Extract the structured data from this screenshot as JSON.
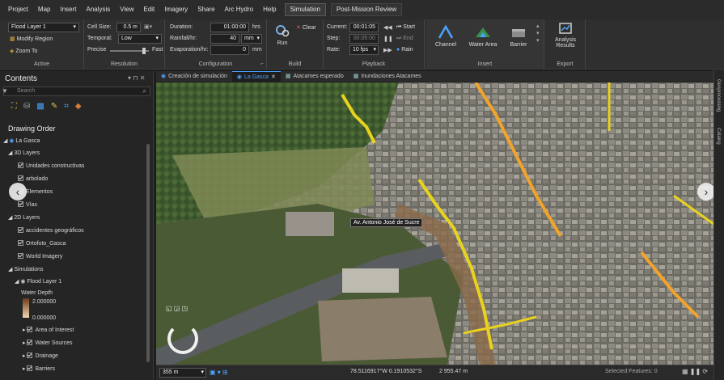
{
  "menu": {
    "items": [
      "Project",
      "Map",
      "Insert",
      "Analysis",
      "View",
      "Edit",
      "Imagery",
      "Share",
      "Arc Hydro",
      "Help"
    ],
    "active_tab": "Simulation",
    "second_tab": "Post-Mission Review"
  },
  "ribbon": {
    "active": {
      "layer_select": "Flood Layer 1",
      "modify_region": "Modify Region",
      "zoom_to": "Zoom To",
      "label": "Active"
    },
    "resolution": {
      "cell_size_label": "Cell Size:",
      "cell_size_value": "0.5 m",
      "temporal_label": "Temporal:",
      "temporal_value": "Low",
      "precise_label": "Precise",
      "fast_label": "Fast",
      "label": "Resolution"
    },
    "configuration": {
      "duration_label": "Duration:",
      "duration_value": "01:00:00",
      "duration_unit": "hrs",
      "rainfall_label": "Rainfall/hr:",
      "rainfall_value": "40",
      "rainfall_unit": "mm",
      "evap_label": "Evaporation/hr:",
      "evap_value": "0",
      "evap_unit": "mm",
      "label": "Configuration"
    },
    "build": {
      "run": "Run",
      "clear": "Clear",
      "label": "Build"
    },
    "playback": {
      "current_label": "Current:",
      "current_value": "00:01:05",
      "step_label": "Step:",
      "step_value": "00:05:00",
      "rate_label": "Rate:",
      "rate_value": "10 fps",
      "start": "Start",
      "end": "End",
      "rain": "Rain",
      "label": "Playback"
    },
    "insert": {
      "channel": "Channel",
      "water_area": "Water Area",
      "barrier": "Barrier",
      "label": "Insert"
    },
    "export": {
      "analysis_results_1": "Analysis",
      "analysis_results_2": "Results",
      "label": "Export"
    }
  },
  "contents": {
    "title": "Contents",
    "search_placeholder": "Search",
    "drawing_order": "Drawing Order",
    "map_name": "La Gasca",
    "groups": {
      "layers_3d": "3D Layers",
      "layers_2d": "2D Layers",
      "simulations": "Simulations"
    },
    "items_3d": [
      "Unidades constructivas",
      "arbolado",
      "Elementos",
      "Vías"
    ],
    "items_2d": [
      "accidentes geográficos",
      "Ortofoto_Gasca",
      "World Imagery"
    ],
    "flood_layer": "Flood Layer 1",
    "water_depth": "Water Depth",
    "depth_max": "2.000000",
    "depth_min": "0.000000",
    "sim_items": [
      "Area of Interest",
      "Water Sources",
      "Drainage",
      "Barriers"
    ]
  },
  "map_tabs": [
    "Creación de simulación",
    "La Gasca",
    "Atacames esperado",
    "Inundaciones Atacames"
  ],
  "map": {
    "street_label": "Av. Antonio José de Sucre"
  },
  "status": {
    "scale": "355 m",
    "coords": "78.5116917°W 0.1910532°S",
    "elevation": "2 955.47 m",
    "selected": "Selected Features: 0"
  },
  "right_strip": [
    "Geoprocessing",
    "Catalog"
  ],
  "colors": {
    "accent": "#4aa3ff",
    "flood_yellow": "#e8d21f",
    "flood_orange": "#f2a32a"
  }
}
